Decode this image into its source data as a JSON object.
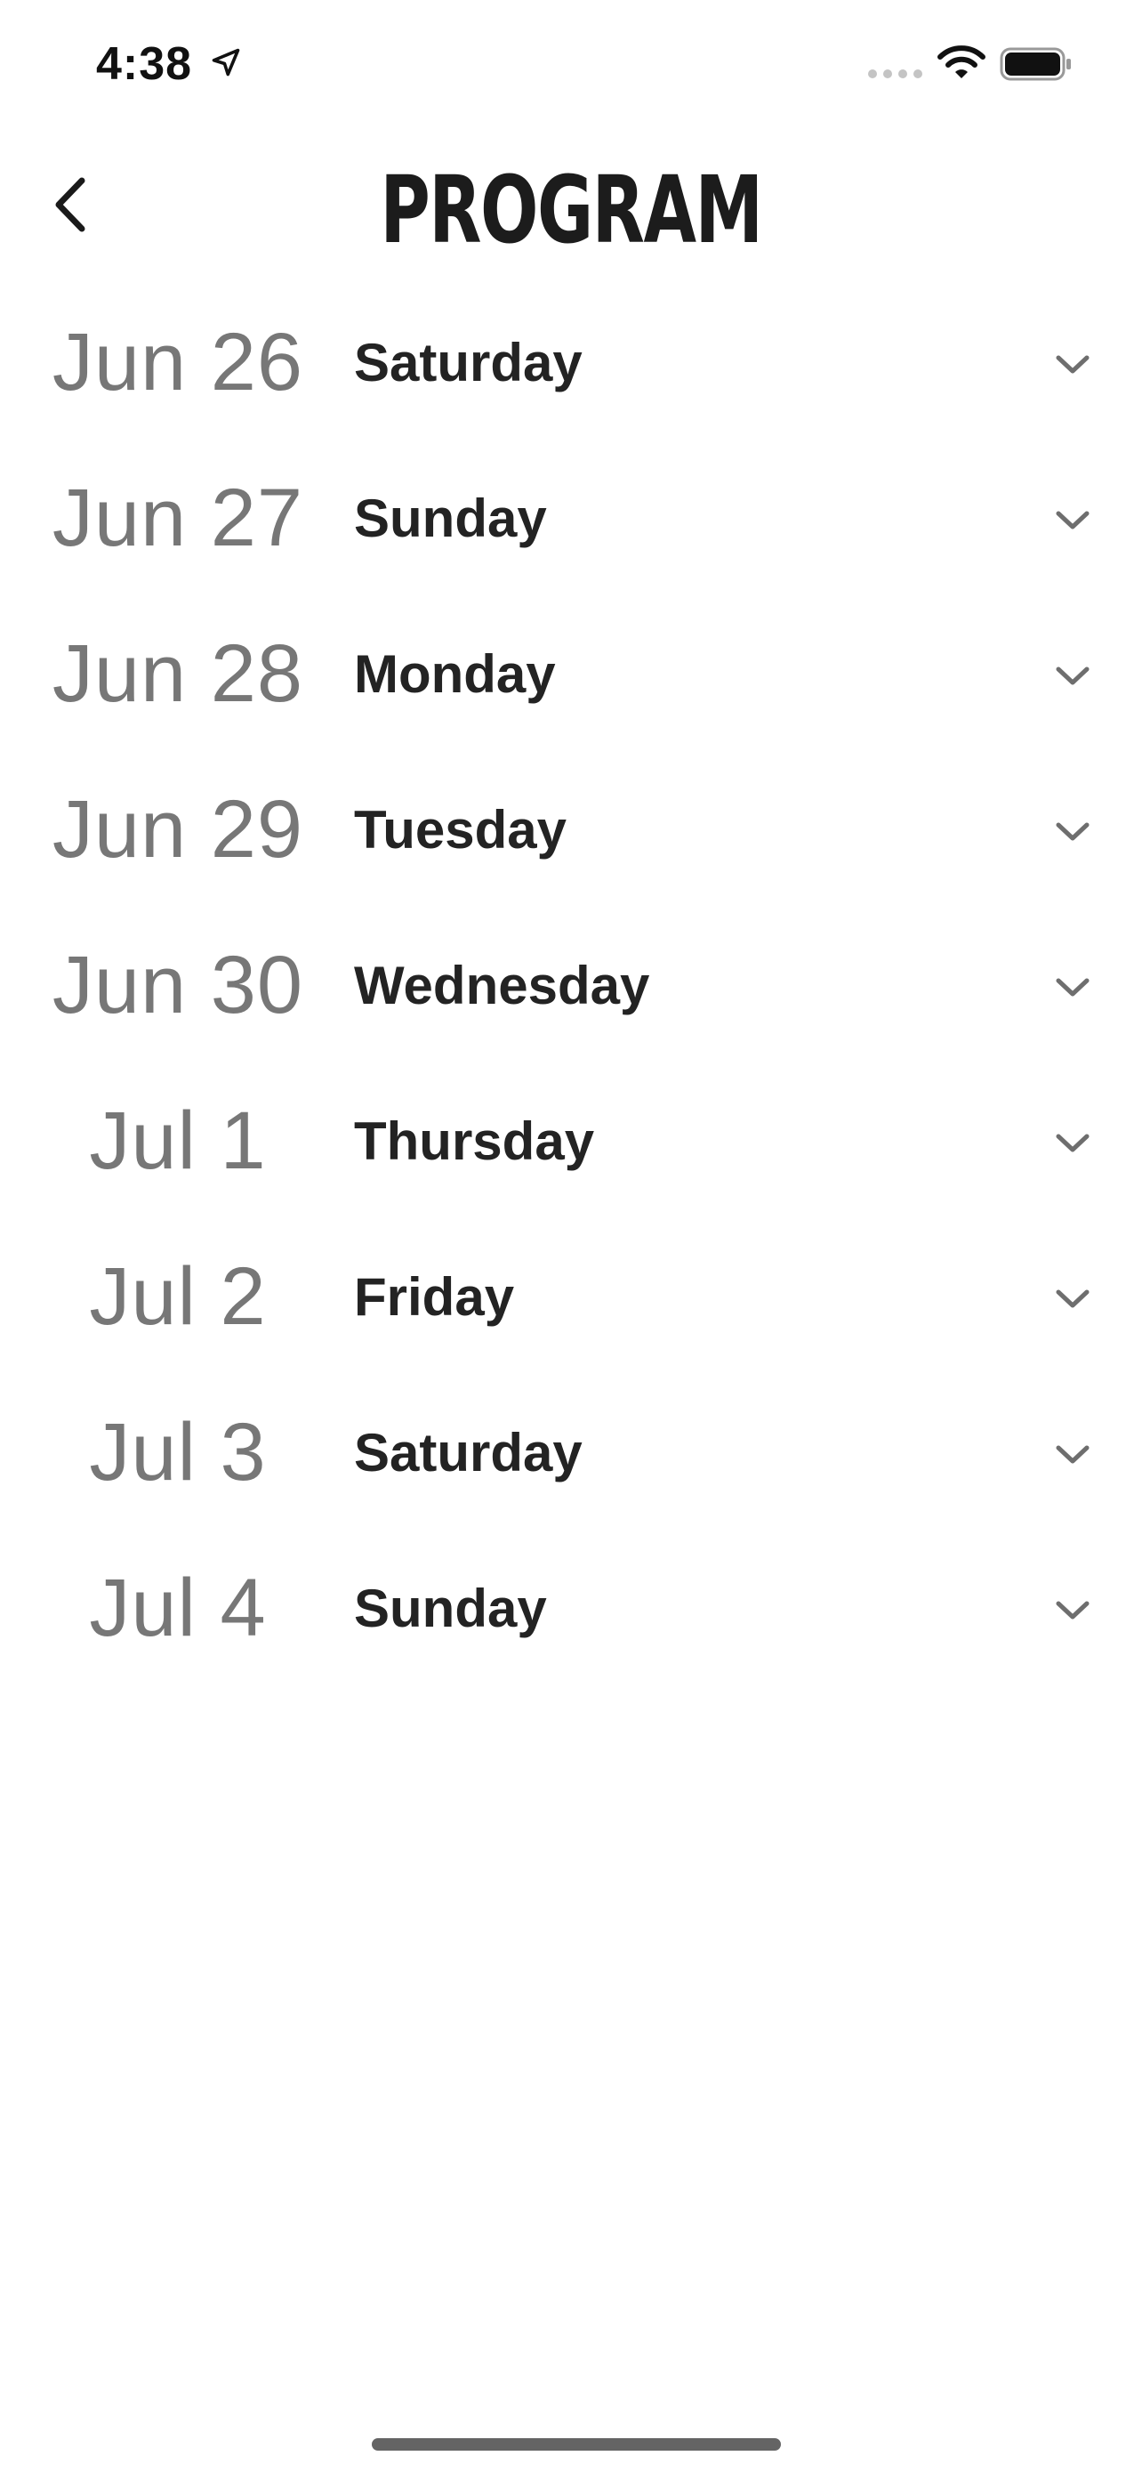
{
  "status_bar": {
    "time": "4:38",
    "icons": [
      "location-arrow-icon",
      "cellular-signal-icon",
      "wifi-icon",
      "battery-icon"
    ]
  },
  "header": {
    "title": "PROGRAM",
    "back_icon": "chevron-left-icon"
  },
  "days": [
    {
      "date": "Jun 26",
      "weekday": "Saturday"
    },
    {
      "date": "Jun 27",
      "weekday": "Sunday"
    },
    {
      "date": "Jun 28",
      "weekday": "Monday"
    },
    {
      "date": "Jun 29",
      "weekday": "Tuesday"
    },
    {
      "date": "Jun 30",
      "weekday": "Wednesday"
    },
    {
      "date": "Jul 1",
      "weekday": "Thursday"
    },
    {
      "date": "Jul 2",
      "weekday": "Friday"
    },
    {
      "date": "Jul 3",
      "weekday": "Saturday"
    },
    {
      "date": "Jul 4",
      "weekday": "Sunday"
    }
  ],
  "colors": {
    "date_text": "#777777",
    "weekday_text": "#232323",
    "title_text": "#1c1c1c",
    "chevron": "#6e6e6e",
    "background": "#ffffff"
  }
}
